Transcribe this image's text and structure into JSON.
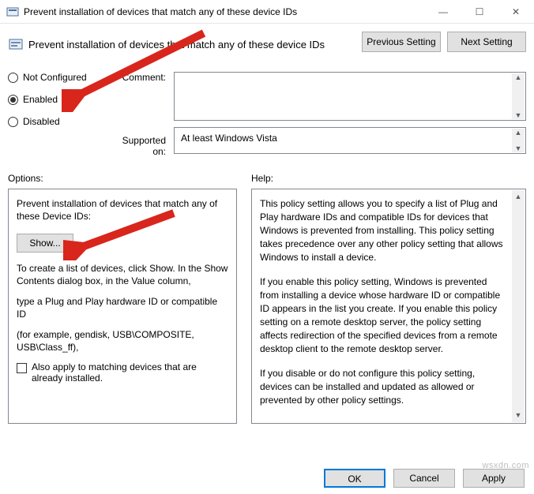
{
  "window": {
    "title": "Prevent installation of devices that match any of these device IDs",
    "min": "—",
    "max": "☐",
    "close": "✕"
  },
  "header": {
    "title": "Prevent installation of devices that match any of these device IDs",
    "prev": "Previous Setting",
    "next": "Next Setting"
  },
  "state": {
    "not_configured": "Not Configured",
    "enabled": "Enabled",
    "disabled": "Disabled",
    "comment_label": "Comment:",
    "comment_value": "",
    "supported_label": "Supported on:",
    "supported_value": "At least Windows Vista"
  },
  "options": {
    "label": "Options:",
    "intro": "Prevent installation of devices that match any of these Device IDs:",
    "show": "Show...",
    "line1": "To create a list of devices, click Show. In the Show Contents dialog box, in the Value column,",
    "line2": "type a Plug and Play hardware ID or compatible ID",
    "line3": "(for example, gendisk, USB\\COMPOSITE, USB\\Class_ff),",
    "checkbox": "Also apply to matching devices that are already installed."
  },
  "help": {
    "label": "Help:",
    "p1": "This policy setting allows you to specify a list of Plug and Play hardware IDs and compatible IDs for devices that Windows is prevented from installing. This policy setting takes precedence over any other policy setting that allows Windows to install a device.",
    "p2": "If you enable this policy setting, Windows is prevented from installing a device whose hardware ID or compatible ID appears in the list you create. If you enable this policy setting on a remote desktop server, the policy setting affects redirection of the specified devices from a remote desktop client to the remote desktop server.",
    "p3": "If you disable or do not configure this policy setting, devices can be installed and updated as allowed or prevented by other policy settings."
  },
  "footer": {
    "ok": "OK",
    "cancel": "Cancel",
    "apply": "Apply"
  },
  "watermark": "wsxdn.com"
}
